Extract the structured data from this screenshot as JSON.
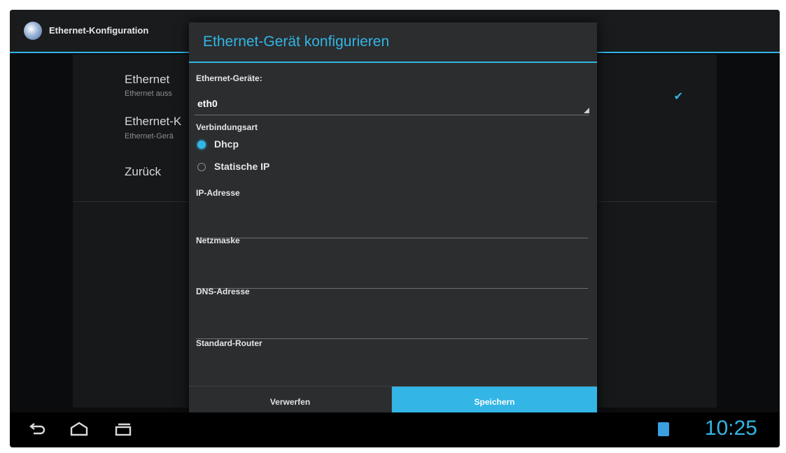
{
  "action_bar": {
    "title": "Ethernet-Konfiguration"
  },
  "settings": {
    "items": [
      {
        "title": "Ethernet",
        "subtitle": "Ethernet auss"
      },
      {
        "title": "Ethernet-K",
        "subtitle": "Ethernet-Gerä"
      },
      {
        "title": "Zurück",
        "subtitle": ""
      }
    ],
    "checkmark": "✔"
  },
  "dialog": {
    "title": "Ethernet-Gerät konfigurieren",
    "device_label": "Ethernet-Geräte:",
    "device_value": "eth0",
    "connection_type_label": "Verbindungsart",
    "radio_options": [
      {
        "label": "Dhcp",
        "checked": true
      },
      {
        "label": "Statische IP",
        "checked": false
      }
    ],
    "fields": [
      {
        "label": "IP-Adresse",
        "value": ""
      },
      {
        "label": "Netzmaske",
        "value": ""
      },
      {
        "label": "DNS-Adresse",
        "value": ""
      },
      {
        "label": "Standard-Router",
        "value": ""
      }
    ],
    "discard_button": "Verwerfen",
    "save_button": "Speichern"
  },
  "navbar": {
    "icons": [
      "back-icon",
      "home-icon",
      "recent-apps-icon"
    ],
    "status_icon": "notification-icon",
    "clock": "10:25"
  },
  "colors": {
    "accent": "#33b5e5",
    "background": "#0b0c0e",
    "dialog": "#2b2d2f"
  }
}
